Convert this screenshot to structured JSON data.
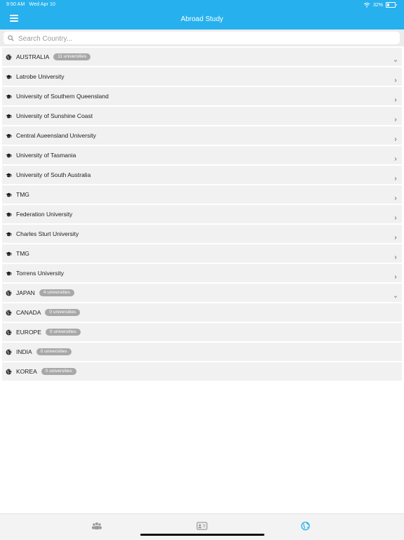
{
  "status_bar": {
    "time": "9:50 AM",
    "date": "Wed Apr 10",
    "battery": "32%"
  },
  "header": {
    "title": "Abroad Study",
    "menu_icon": "hamburger-menu-icon"
  },
  "search": {
    "placeholder": "Search Country...",
    "value": ""
  },
  "accent_color": "#26b0ee",
  "countries": [
    {
      "name": "AUSTRALIA",
      "badge": "11 universities",
      "expanded": true,
      "universities": [
        "Latrobe University",
        "University of Southern Queensland",
        "University of Sunshine Coast",
        "Central Aueensland University",
        "University of Tasmania",
        "University of South Australia",
        "TMG",
        "Federation University",
        "Charles Sturt University",
        "TMG",
        "Torrens University"
      ]
    },
    {
      "name": "JAPAN",
      "badge": "4 universities",
      "expanded": false,
      "universities": []
    },
    {
      "name": "CANADA",
      "badge": "0 universities",
      "expanded": false,
      "universities": []
    },
    {
      "name": "EUROPE",
      "badge": "0 universities",
      "expanded": false,
      "universities": []
    },
    {
      "name": "INDIA",
      "badge": "0 universities",
      "expanded": false,
      "universities": []
    },
    {
      "name": "KOREA",
      "badge": "0 universities",
      "expanded": false,
      "universities": []
    }
  ],
  "tabbar": {
    "tabs": [
      {
        "icon": "people-icon",
        "active": false
      },
      {
        "icon": "id-card-icon",
        "active": false
      },
      {
        "icon": "globe-icon",
        "active": true
      }
    ]
  }
}
